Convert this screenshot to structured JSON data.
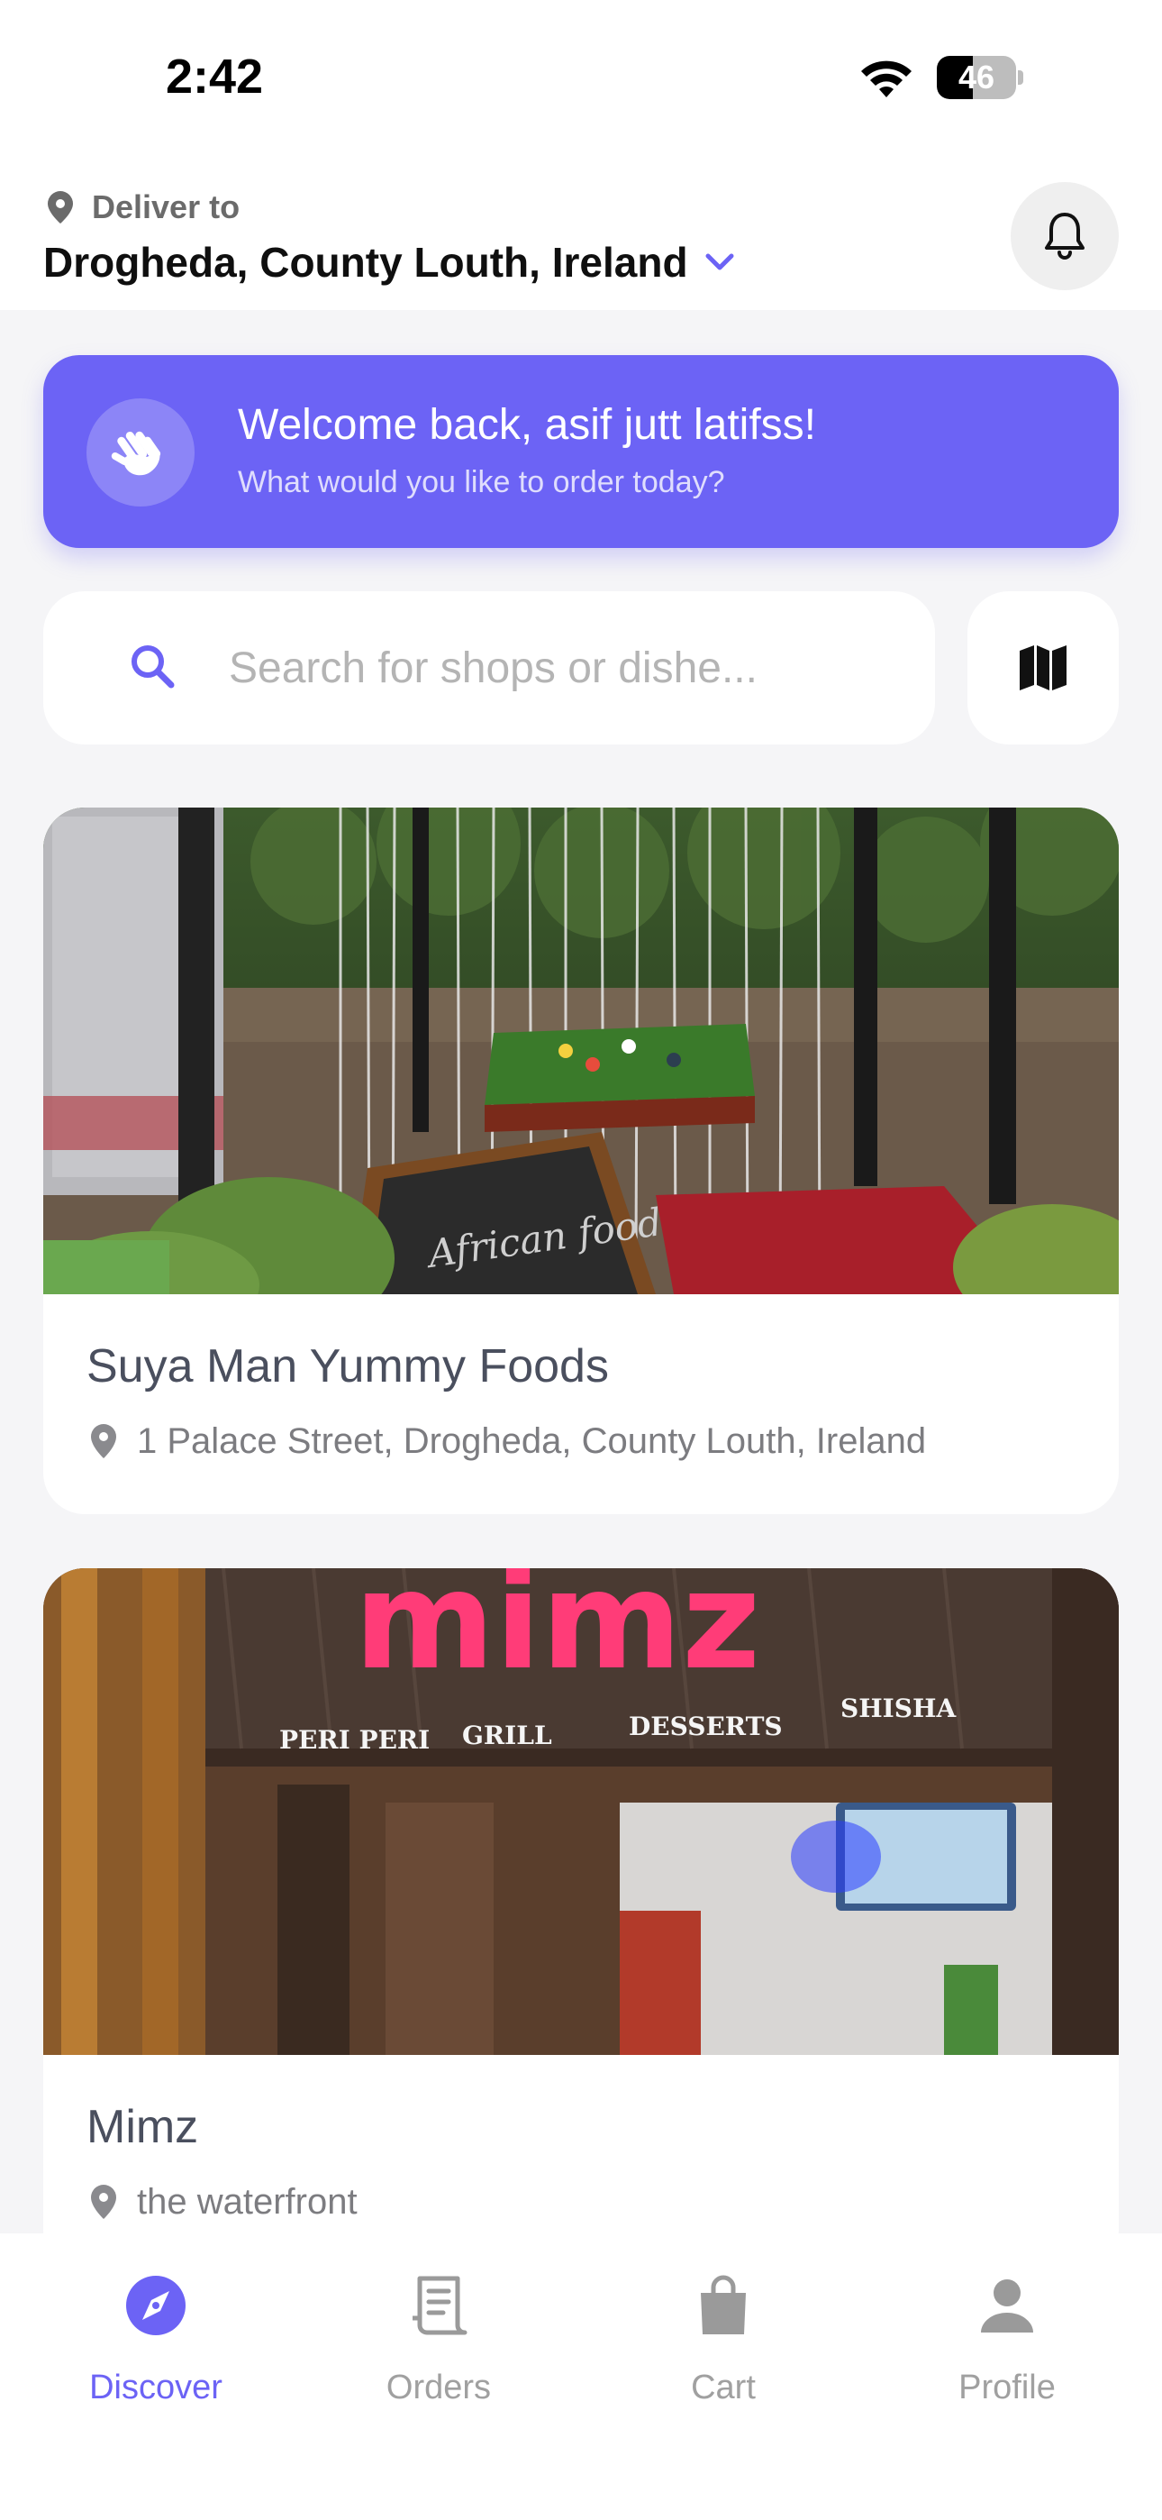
{
  "status_bar": {
    "time": "2:42",
    "battery": "46",
    "battery_level": 0.46
  },
  "header": {
    "deliver_label": "Deliver to",
    "location": "Drogheda, County Louth, Ireland",
    "accent_color": "#6c63f5"
  },
  "welcome": {
    "title": "Welcome back, asif jutt latifss!",
    "subtitle": "What would you like to order today?"
  },
  "search": {
    "placeholder": "Search for shops or dishe..."
  },
  "shops": [
    {
      "name": "Suya Man Yummy Foods",
      "address": "1 Palace Street, Drogheda, County Louth, Ireland",
      "image_sign": "African food"
    },
    {
      "name": "Mimz",
      "address": "the waterfront",
      "sign_main": "mimz",
      "sign_items": [
        "PERI PERI",
        "GRILL",
        "DESSERTS",
        "SHISHA"
      ]
    }
  ],
  "nav": {
    "items": [
      {
        "label": "Discover",
        "icon": "compass-icon",
        "active": true
      },
      {
        "label": "Orders",
        "icon": "receipt-icon",
        "active": false
      },
      {
        "label": "Cart",
        "icon": "shopping-bag-icon",
        "active": false
      },
      {
        "label": "Profile",
        "icon": "person-icon",
        "active": false
      }
    ]
  }
}
